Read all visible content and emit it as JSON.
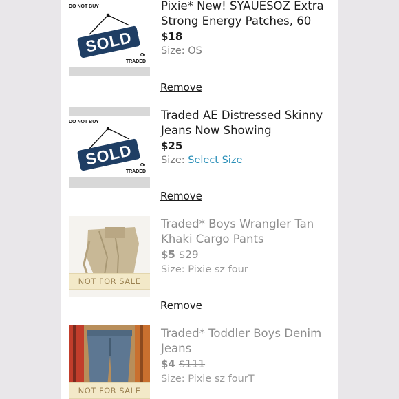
{
  "items": [
    {
      "title": "Pixie* New! SYAUESOZ Extra Strong Energy Patches, 60",
      "price": "$18",
      "size_label": "Size: OS",
      "remove": "Remove",
      "image": {
        "top": "DO NOT BUY",
        "sign": "SOLD",
        "or": "Or",
        "traded": "TRADED"
      }
    },
    {
      "title": "Traded AE Distressed Skinny Jeans Now Showing",
      "price": "$25",
      "size_prefix": "Size:",
      "size_link": "Select Size",
      "remove": "Remove",
      "image": {
        "top": "DO NOT BUY",
        "sign": "SOLD",
        "or": "Or",
        "traded": "TRADED"
      }
    },
    {
      "title": "Traded* Boys Wrangler Tan Khaki Cargo Pants",
      "price": "$5",
      "original_price": "$29",
      "size_label": "Size: Pixie sz four",
      "remove": "Remove",
      "badge": "NOT FOR SALE"
    },
    {
      "title": "Traded* Toddler Boys Denim Jeans",
      "price": "$4",
      "original_price": "$111",
      "size_label": "Size: Pixie sz fourT",
      "badge": "NOT FOR SALE"
    }
  ],
  "colors": {
    "link": "#2a8fb8",
    "sold_sign": "#1f3e64",
    "badge_bg": "#f3e9c8",
    "badge_text": "#9b8253"
  }
}
